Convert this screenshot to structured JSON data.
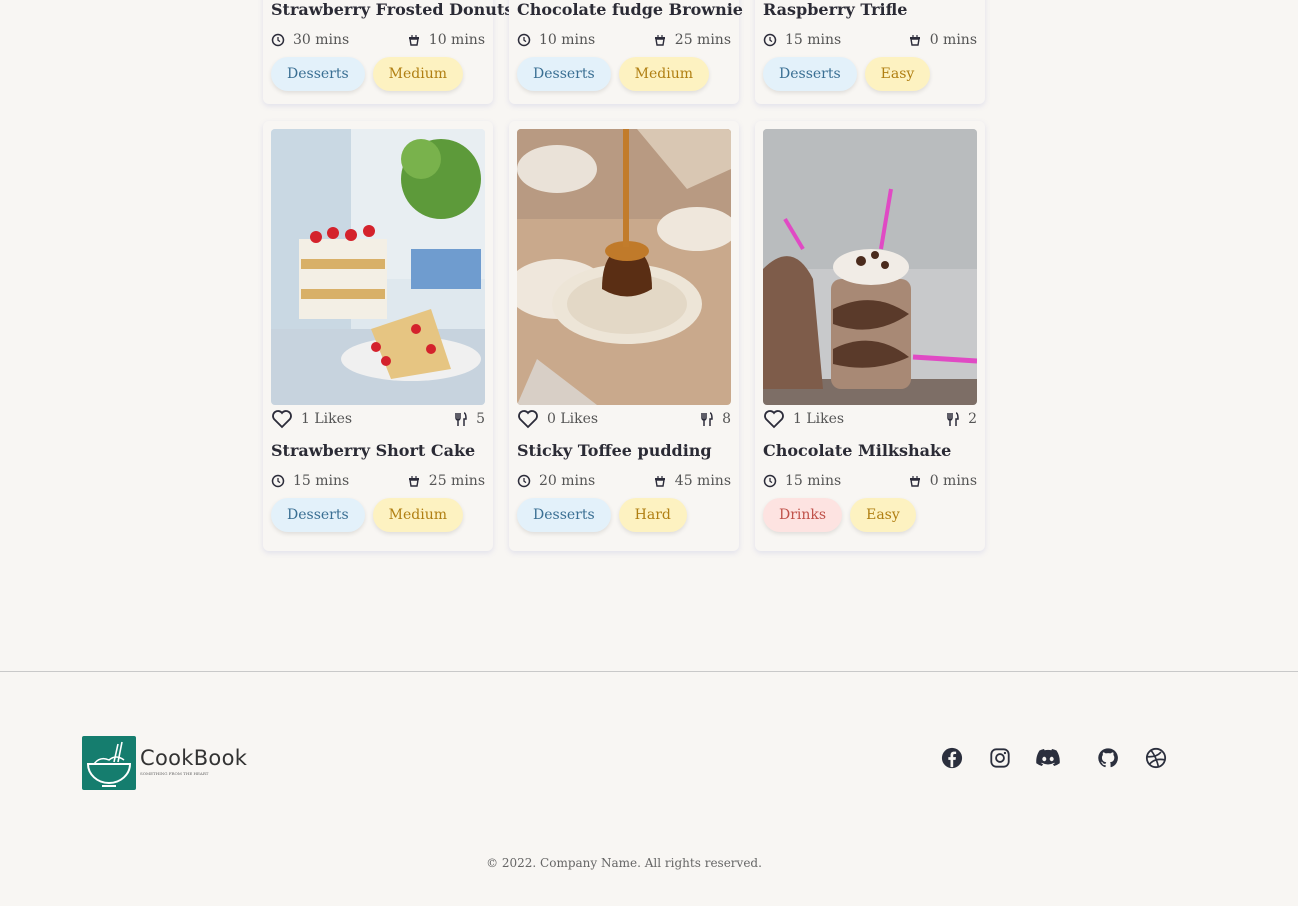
{
  "cards_top": [
    {
      "title": "Strawberry Frosted Donuts",
      "prep": "30 mins",
      "cook": "10 mins",
      "category": "Desserts",
      "category_color": "blue",
      "difficulty": "Medium"
    },
    {
      "title": "Chocolate fudge Brownie",
      "prep": "10 mins",
      "cook": "25 mins",
      "category": "Desserts",
      "category_color": "blue",
      "difficulty": "Medium"
    },
    {
      "title": "Raspberry Trifle",
      "prep": "15 mins",
      "cook": "0 mins",
      "category": "Desserts",
      "category_color": "blue",
      "difficulty": "Easy"
    }
  ],
  "cards": [
    {
      "likes": "1 Likes",
      "servings": "5",
      "title": "Strawberry Short Cake",
      "prep": "15 mins",
      "cook": "25 mins",
      "category": "Desserts",
      "difficulty": "Medium"
    },
    {
      "likes": "0 Likes",
      "servings": "8",
      "title": "Sticky Toffee pudding",
      "prep": "20 mins",
      "cook": "45 mins",
      "category": "Desserts",
      "difficulty": "Hard"
    },
    {
      "likes": "1 Likes",
      "servings": "2",
      "title": "Chocolate Milkshake",
      "prep": "15 mins",
      "cook": "0 mins",
      "category": "Drinks",
      "difficulty": "Easy"
    }
  ],
  "footer": {
    "brand": "CookBook",
    "tagline": "SOMETHING FROM THE HEART",
    "copyright": "© 2022. Company Name. All rights reserved.",
    "social": [
      "facebook-icon",
      "instagram-icon",
      "discord-icon",
      "github-icon",
      "dribbble-icon"
    ]
  },
  "colors": {
    "background": "#f8f6f3",
    "brand": "#157d6e",
    "desserts_badge": "#e3f1fa",
    "drinks_badge": "#fde3e1",
    "difficulty_badge": "#fdf2c1"
  }
}
